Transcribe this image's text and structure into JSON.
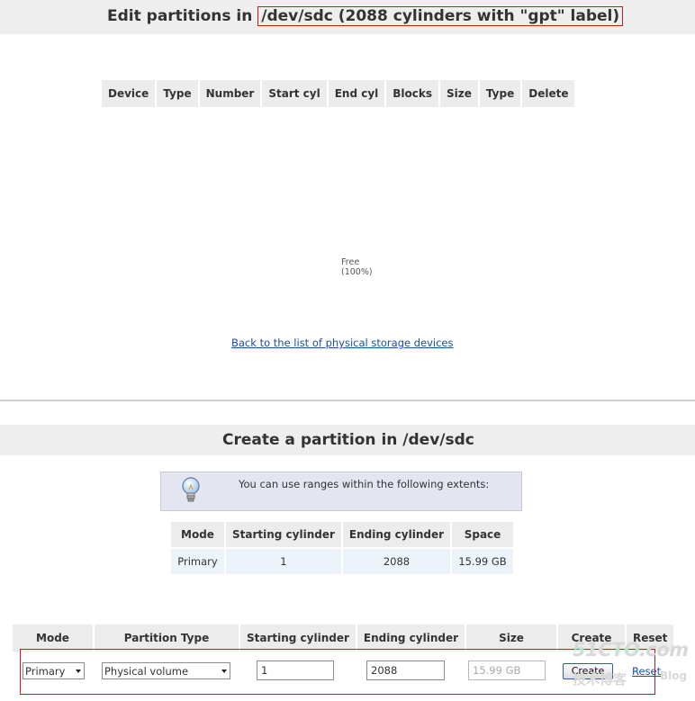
{
  "edit": {
    "title_prefix": "Edit partitions in",
    "title_highlight": "/dev/sdc (2088 cylinders with \"gpt\" label)",
    "columns": [
      "Device",
      "Type",
      "Number",
      "Start cyl",
      "End cyl",
      "Blocks",
      "Size",
      "Type",
      "Delete"
    ],
    "free_label": "Free",
    "free_percent": "(100%)",
    "back_link": "Back to the list of physical storage devices"
  },
  "create": {
    "title": "Create a partition in /dev/sdc",
    "info_text": "You can use ranges within the following extents:",
    "extents_columns": [
      "Mode",
      "Starting cylinder",
      "Ending cylinder",
      "Space"
    ],
    "extents_rows": [
      [
        "Primary",
        "1",
        "2088",
        "15.99 GB"
      ]
    ],
    "form_columns": [
      "Mode",
      "Partition Type",
      "Starting cylinder",
      "Ending cylinder",
      "Size",
      "Create",
      "Reset"
    ],
    "form": {
      "mode": "Primary",
      "partition_type": "Physical volume",
      "start_cyl": "1",
      "end_cyl": "2088",
      "size": "15.99 GB",
      "create_label": "Create",
      "reset_label": "Reset"
    }
  },
  "watermark": {
    "main": "51CTO.com",
    "sub": "技术博客",
    "blog": "Blog"
  },
  "colors": {
    "header_bg": "#eeeeee",
    "highlight_border": "#d01818",
    "link": "#1a4fa0"
  }
}
